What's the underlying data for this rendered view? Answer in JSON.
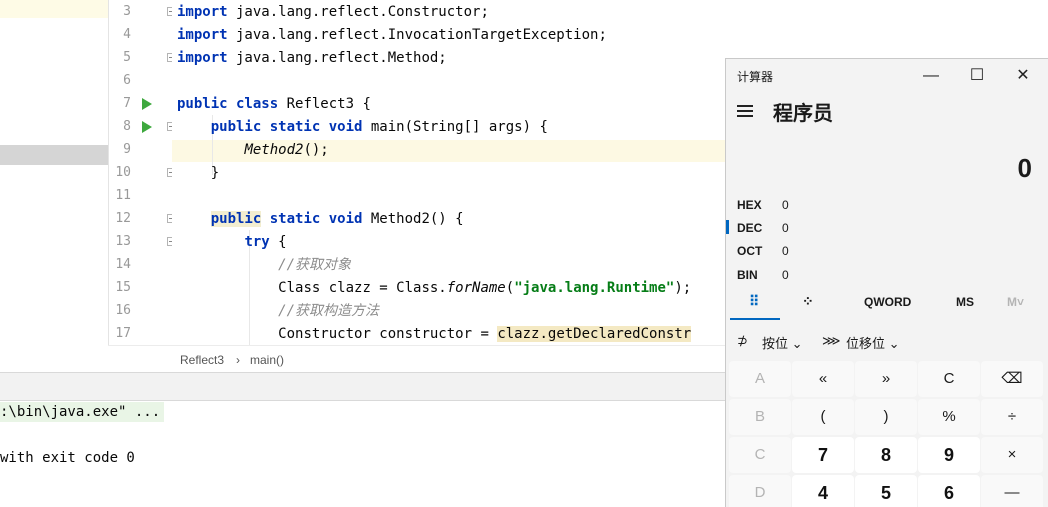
{
  "editor": {
    "line_numbers": [
      "3",
      "4",
      "5",
      "6",
      "7",
      "8",
      "9",
      "10",
      "11",
      "12",
      "13",
      "14",
      "15",
      "16",
      "17"
    ],
    "lines": [
      {
        "kw": "import",
        "rest": " java.lang.reflect.Constructor;"
      },
      {
        "kw": "import",
        "rest": " java.lang.reflect.InvocationTargetException;"
      },
      {
        "kw": "import",
        "rest": " java.lang.reflect.Method;"
      },
      {
        "rest": ""
      },
      {
        "kw": "public class",
        "rest": " Reflect3 {"
      },
      {
        "indent": "    ",
        "kw": "public static void",
        "rest": " main(String[] args) {"
      },
      {
        "indent": "        ",
        "call": "Method2",
        "rest": "();"
      },
      {
        "indent": "    ",
        "rest": "}"
      },
      {
        "rest": ""
      },
      {
        "indent": "    ",
        "kw_hl": "public",
        "kw": " static void",
        "rest": " Method2() {"
      },
      {
        "indent": "        ",
        "kw": "try",
        "rest": " {"
      },
      {
        "indent": "            ",
        "comment": "//获取对象"
      },
      {
        "indent": "            ",
        "a": "Class clazz = Class.",
        "call": "forName",
        "b": "(",
        "str": "\"java.lang.Runtime\"",
        "rest": ");"
      },
      {
        "indent": "            ",
        "comment": "//获取构造方法"
      },
      {
        "indent": "            ",
        "a": "Constructor constructor = ",
        "hl": "clazz.getDeclaredConstr"
      }
    ]
  },
  "breadcrumb": {
    "class_name": "Reflect3",
    "separator": "›",
    "method": "main()"
  },
  "console": {
    "line1": ":\\bin\\java.exe\" ...",
    "line2": "with exit code 0"
  },
  "calculator": {
    "title": "计算器",
    "window_controls": {
      "minimize": "—",
      "maximize": "☐",
      "close": "✕"
    },
    "mode": "程序员",
    "display": "0",
    "radix": [
      {
        "label": "HEX",
        "value": "0"
      },
      {
        "label": "DEC",
        "value": "0"
      },
      {
        "label": "OCT",
        "value": "0"
      },
      {
        "label": "BIN",
        "value": "0"
      }
    ],
    "tabs": {
      "keypad": "⠿",
      "bits": "⁘",
      "qword": "QWORD",
      "ms": "MS",
      "mem": "M˅"
    },
    "toolbar": {
      "bitwise": "按位",
      "bitshift": "位移位"
    },
    "keys": [
      [
        "A",
        "«",
        "»",
        "C",
        "⌫"
      ],
      [
        "B",
        "(",
        ")",
        "%",
        "÷"
      ],
      [
        "C",
        "7",
        "8",
        "9",
        "×"
      ],
      [
        "D",
        "4",
        "5",
        "6",
        "—"
      ]
    ]
  }
}
